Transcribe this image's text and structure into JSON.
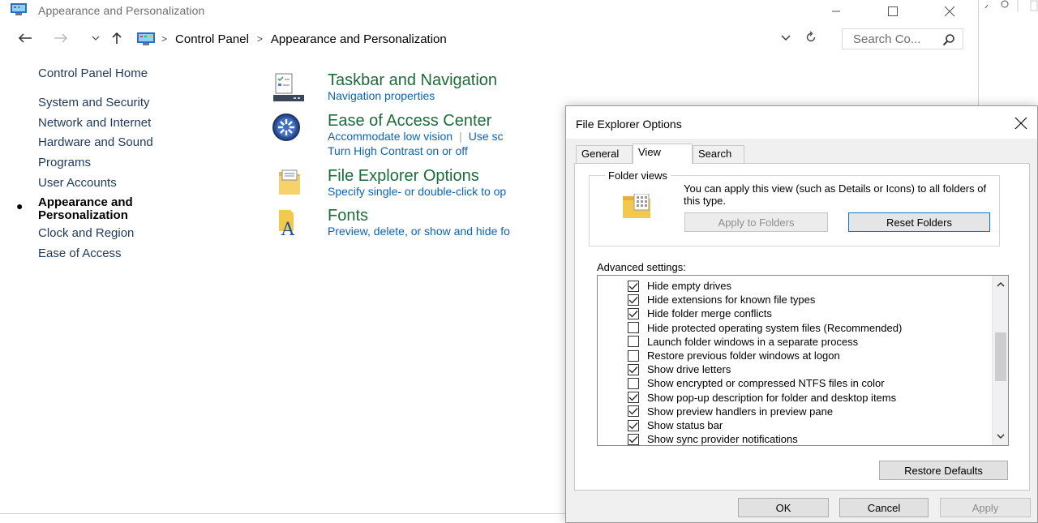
{
  "control_panel": {
    "window_title": "Appearance and Personalization",
    "address": {
      "crumbs": [
        "Control Panel",
        "Appearance and Personalization"
      ],
      "search_placeholder": "Search Co..."
    },
    "nav": {
      "home": "Control Panel Home",
      "items": [
        "System and Security",
        "Network and Internet",
        "Hardware and Sound",
        "Programs",
        "User Accounts",
        "Appearance and",
        "Personalization",
        "Clock and Region",
        "Ease of Access"
      ]
    },
    "categories": [
      {
        "title": "Taskbar and Navigation",
        "links": [
          "Navigation properties"
        ]
      },
      {
        "title": "Ease of Access Center",
        "links": [
          "Accommodate low vision",
          "Use sc",
          "Turn High Contrast on or off"
        ]
      },
      {
        "title": "File Explorer Options",
        "links": [
          "Specify single- or double-click to op"
        ]
      },
      {
        "title": "Fonts",
        "links": [
          "Preview, delete, or show and hide fo"
        ]
      }
    ],
    "accent_colors": {
      "category_title": "#1e6b3a",
      "link": "#0b63b7",
      "nav": "#1e395b"
    }
  },
  "dialog": {
    "title": "File Explorer Options",
    "tabs": [
      "General",
      "View",
      "Search"
    ],
    "active_tab": "View",
    "folder_views": {
      "legend": "Folder views",
      "description": "You can apply this view (such as Details or Icons) to all folders of this type.",
      "apply_button": "Apply to Folders",
      "reset_button": "Reset Folders"
    },
    "advanced_label": "Advanced settings:",
    "advanced_items": [
      {
        "label": "Hide empty drives",
        "checked": true
      },
      {
        "label": "Hide extensions for known file types",
        "checked": true
      },
      {
        "label": "Hide folder merge conflicts",
        "checked": true
      },
      {
        "label": "Hide protected operating system files (Recommended)",
        "checked": false
      },
      {
        "label": "Launch folder windows in a separate process",
        "checked": false
      },
      {
        "label": "Restore previous folder windows at logon",
        "checked": false
      },
      {
        "label": "Show drive letters",
        "checked": true
      },
      {
        "label": "Show encrypted or compressed NTFS files in color",
        "checked": false
      },
      {
        "label": "Show pop-up description for folder and desktop items",
        "checked": true
      },
      {
        "label": "Show preview handlers in preview pane",
        "checked": true
      },
      {
        "label": "Show status bar",
        "checked": true
      },
      {
        "label": "Show sync provider notifications",
        "checked": true
      }
    ],
    "restore_defaults": "Restore Defaults",
    "ok": "OK",
    "cancel": "Cancel",
    "apply": "Apply"
  }
}
